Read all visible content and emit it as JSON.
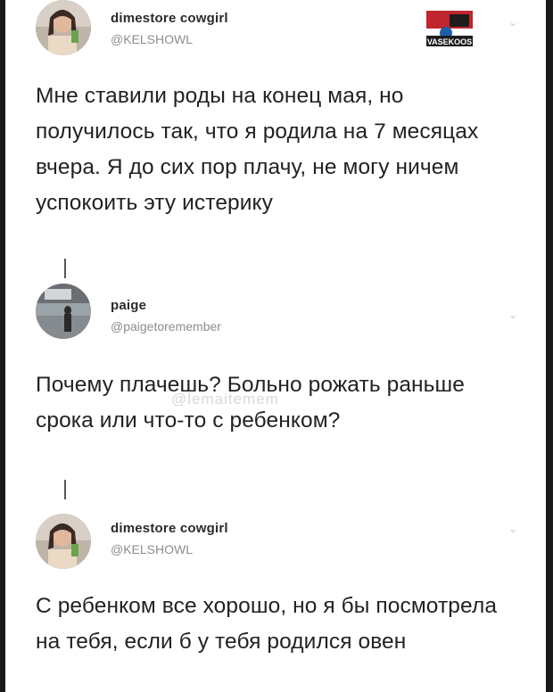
{
  "tweets": [
    {
      "name": "dimestore cowgirl",
      "handle": "@KELSHOWL",
      "text": "Мне ставили роды на конец мая, но получилось так, что я родила на 7 месяцах вчера. Я до сих пор плачу, не могу ничем успокоить эту истерику"
    },
    {
      "name": "paige",
      "handle": "@paigetoremember",
      "text": "Почему плачешь? Больно рожать раньше срока или что-то с ребенком?"
    },
    {
      "name": "dimestore cowgirl",
      "handle": "@KELSHOWL",
      "text": "С ребенком все хорошо, но я бы посмотрела на тебя, если б у тебя родился овен"
    }
  ],
  "watermark": "@lemaitemem",
  "logo_text": "VASEKOOS",
  "icons": {
    "chevron": "chevron-down-icon",
    "avatar": "avatar"
  },
  "colors": {
    "text": "#222222",
    "handle": "#8d8d8d",
    "logo_red": "#c0262d"
  }
}
